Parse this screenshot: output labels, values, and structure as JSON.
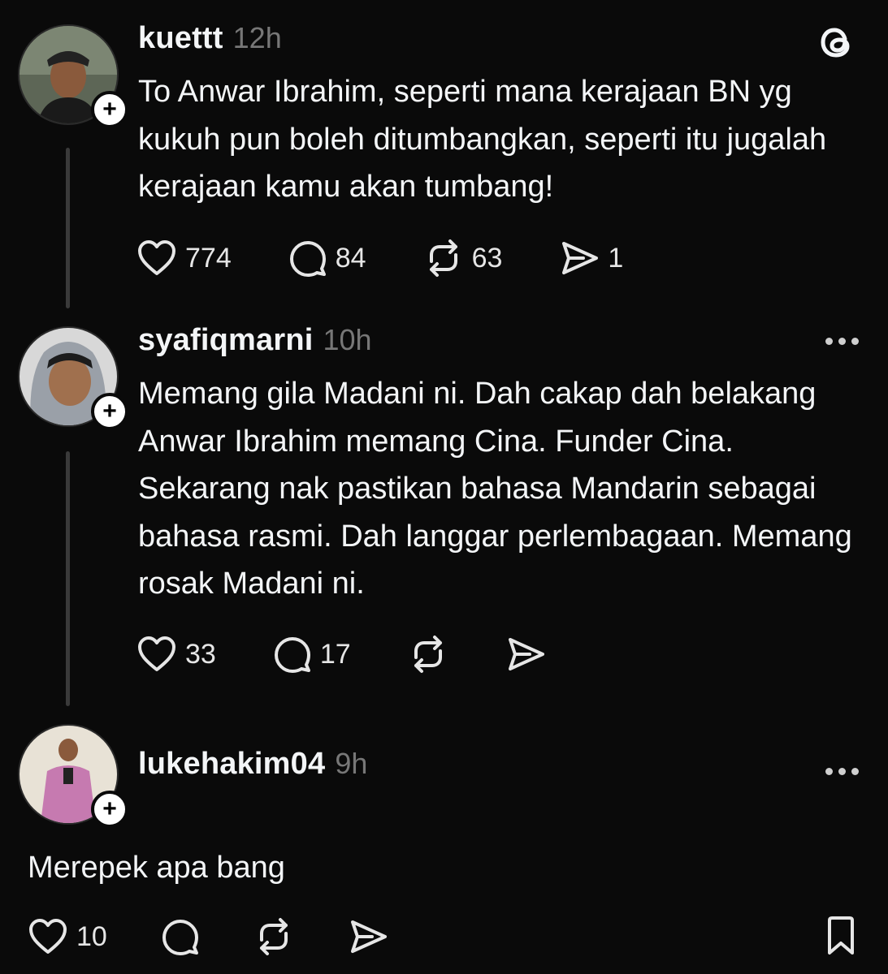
{
  "posts": [
    {
      "username": "kuettt",
      "time": "12h",
      "text": "To Anwar Ibrahim, seperti mana kerajaan BN yg kukuh pun boleh ditumbangkan, seperti itu jugalah kerajaan kamu akan tumbang!",
      "likes": "774",
      "replies": "84",
      "reposts": "63",
      "shares": "1"
    },
    {
      "username": "syafiqmarni",
      "time": "10h",
      "text": "Memang gila Madani ni. Dah cakap dah belakang Anwar Ibrahim memang Cina. Funder Cina. Sekarang nak pastikan bahasa Mandarin sebagai bahasa rasmi. Dah langgar perlembagaan. Memang rosak Madani ni.",
      "likes": "33",
      "replies": "17"
    },
    {
      "username": "lukehakim04",
      "time": "9h",
      "text": "Merepek apa bang",
      "likes": "10"
    }
  ],
  "icons": {
    "app_logo": "threads-logo-icon",
    "like": "heart-icon",
    "reply": "comment-icon",
    "repost": "repost-icon",
    "share": "send-icon",
    "more": "more-icon",
    "follow": "plus-icon",
    "bookmark": "bookmark-icon"
  },
  "colors": {
    "background": "#0a0a0a",
    "text": "#f3f5f7",
    "muted": "#777777",
    "thread_line": "#3a3a3a"
  }
}
